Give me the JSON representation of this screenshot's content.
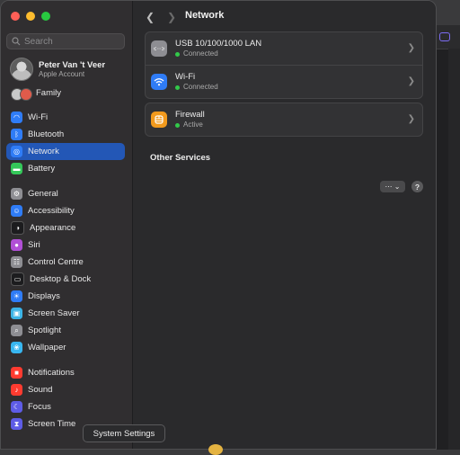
{
  "sidebar": {
    "search_placeholder": "Search",
    "account": {
      "name": "Peter Van 't Veer",
      "subtitle": "Apple Account"
    },
    "family_label": "Family",
    "items": [
      {
        "label": "Wi-Fi",
        "icon": "wifi-icon",
        "color": "#2f7cf6",
        "selected": false
      },
      {
        "label": "Bluetooth",
        "icon": "bluetooth-icon",
        "color": "#2f7cf6",
        "selected": false
      },
      {
        "label": "Network",
        "icon": "globe-icon",
        "color": "#2f7cf6",
        "selected": true
      },
      {
        "label": "Battery",
        "icon": "battery-icon",
        "color": "#34c759",
        "selected": false
      },
      {
        "label": "General",
        "icon": "gear-icon",
        "color": "#8e8e93",
        "selected": false
      },
      {
        "label": "Accessibility",
        "icon": "accessibility-icon",
        "color": "#2f7cf6",
        "selected": false
      },
      {
        "label": "Appearance",
        "icon": "appearance-icon",
        "color": "#1c1c1e",
        "selected": false
      },
      {
        "label": "Siri",
        "icon": "siri-icon",
        "color": "#b14fd6",
        "selected": false
      },
      {
        "label": "Control Centre",
        "icon": "control-centre-icon",
        "color": "#8e8e93",
        "selected": false
      },
      {
        "label": "Desktop & Dock",
        "icon": "dock-icon",
        "color": "#1c1c1e",
        "selected": false
      },
      {
        "label": "Displays",
        "icon": "displays-icon",
        "color": "#2f7cf6",
        "selected": false
      },
      {
        "label": "Screen Saver",
        "icon": "screen-saver-icon",
        "color": "#3cb4e6",
        "selected": false
      },
      {
        "label": "Spotlight",
        "icon": "spotlight-icon",
        "color": "#8e8e93",
        "selected": false
      },
      {
        "label": "Wallpaper",
        "icon": "wallpaper-icon",
        "color": "#38b6f0",
        "selected": false
      },
      {
        "label": "Notifications",
        "icon": "notifications-icon",
        "color": "#ff3b30",
        "selected": false
      },
      {
        "label": "Sound",
        "icon": "sound-icon",
        "color": "#ff3b30",
        "selected": false
      },
      {
        "label": "Focus",
        "icon": "focus-icon",
        "color": "#5e5ce6",
        "selected": false
      },
      {
        "label": "Screen Time",
        "icon": "screen-time-icon",
        "color": "#5e5ce6",
        "selected": false
      }
    ]
  },
  "header": {
    "title": "Network"
  },
  "network": {
    "services": [
      {
        "name": "USB 10/100/1000 LAN",
        "status": "Connected",
        "icon": "ethernet-icon"
      },
      {
        "name": "Wi-Fi",
        "status": "Connected",
        "icon": "wifi-icon"
      }
    ],
    "firewall": {
      "name": "Firewall",
      "status": "Active",
      "icon": "firewall-icon"
    },
    "other_services_title": "Other Services",
    "more_button": "⋯ ⌄",
    "help_button": "?"
  },
  "dock": {
    "tooltip": "System Settings"
  },
  "colors": {
    "accent": "#2357b6",
    "status_green": "#32c94a"
  }
}
